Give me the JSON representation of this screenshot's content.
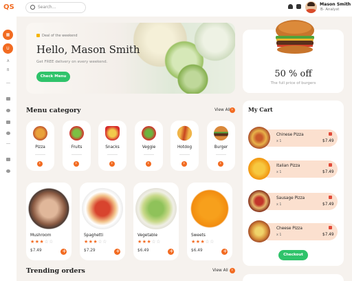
{
  "app": {
    "logo": "QS"
  },
  "search": {
    "placeholder": "Search..."
  },
  "user": {
    "name": "Mason Smith",
    "role": "B- Analyst"
  },
  "rail": {
    "icons": [
      "grid-icon",
      "user-icon",
      "chart-icon",
      "settings-icon",
      "mail-icon",
      "calendar-icon",
      "truck-icon",
      "search-icon",
      "wallet-icon",
      "gear-icon"
    ],
    "letters": [
      "U",
      "A",
      "B"
    ]
  },
  "banner": {
    "deal": "Deal of the weekend",
    "greeting": "Hello, Mason Smith",
    "subtitle": "Get FREE delivery on every weekend.",
    "button": "Check Menu"
  },
  "promo": {
    "percent": "50 % off",
    "subtitle": "The full price of burgers"
  },
  "menu": {
    "title": "Menu category",
    "view_all": "View All",
    "categories": [
      {
        "label": "Pizza"
      },
      {
        "label": "Fruits"
      },
      {
        "label": "Snacks"
      },
      {
        "label": "Veggie"
      },
      {
        "label": "Hotdog"
      },
      {
        "label": "Burger"
      }
    ]
  },
  "dishes": [
    {
      "name": "Mushroom",
      "price": "$7.49",
      "rating": 3
    },
    {
      "name": "Spaghetti",
      "price": "$7.29",
      "rating": 3
    },
    {
      "name": "Vegetable",
      "price": "$6.49",
      "rating": 3
    },
    {
      "name": "Sweets",
      "price": "$6.49",
      "rating": 3
    }
  ],
  "trending": {
    "title": "Trending orders",
    "view_all": "View All"
  },
  "cart": {
    "title": "My Cart",
    "items": [
      {
        "name": "Chinese Pizza",
        "qty": "x 1",
        "price": "$7.49"
      },
      {
        "name": "Italian Pizza",
        "qty": "x 1",
        "price": "$7.49"
      },
      {
        "name": "Sausage Pizza",
        "qty": "x 1",
        "price": "$7.49"
      },
      {
        "name": "Cheese Pizza",
        "qty": "x 1",
        "price": "$7.49"
      }
    ],
    "checkout": "Checkout"
  },
  "colors": {
    "accent": "#f26b21",
    "green": "#2fc36a",
    "cart_item_bg": "#fbe0cf"
  }
}
